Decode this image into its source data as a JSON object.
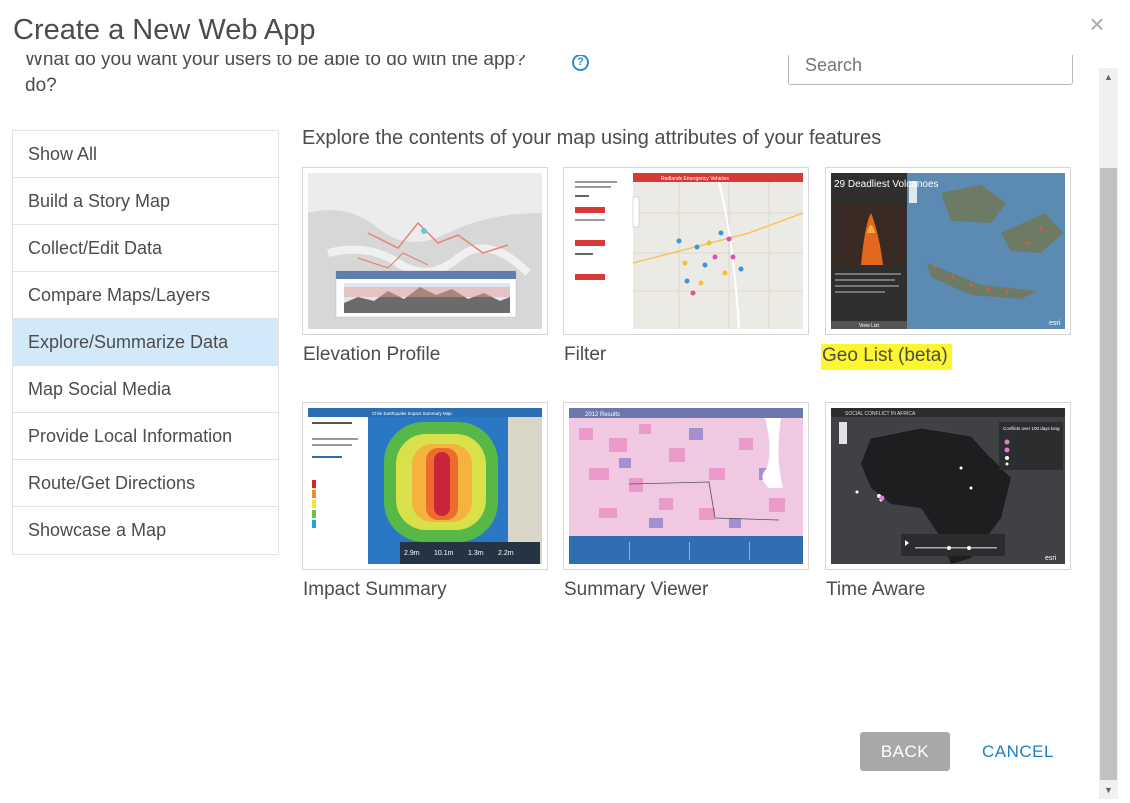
{
  "dialog": {
    "title": "Create a New Web App",
    "close_icon": "close-icon"
  },
  "question": {
    "line1_partial": "What do you want your users to be able to do with the app?",
    "line2": "do?",
    "help_icon": "help-icon"
  },
  "search": {
    "placeholder": "Search"
  },
  "categories": [
    {
      "label": "Show All",
      "selected": false
    },
    {
      "label": "Build a Story Map",
      "selected": false
    },
    {
      "label": "Collect/Edit Data",
      "selected": false
    },
    {
      "label": "Compare Maps/Layers",
      "selected": false
    },
    {
      "label": "Explore/Summarize Data",
      "selected": true
    },
    {
      "label": "Map Social Media",
      "selected": false
    },
    {
      "label": "Provide Local Information",
      "selected": false
    },
    {
      "label": "Route/Get Directions",
      "selected": false
    },
    {
      "label": "Showcase a Map",
      "selected": false
    }
  ],
  "section": {
    "heading": "Explore the contents of your map using attributes of your features"
  },
  "apps": [
    {
      "label": "Elevation Profile",
      "highlighted": false
    },
    {
      "label": "Filter",
      "highlighted": false
    },
    {
      "label": "Geo List (beta)",
      "highlighted": true
    },
    {
      "label": "Impact Summary",
      "highlighted": false
    },
    {
      "label": "Summary Viewer",
      "highlighted": false
    },
    {
      "label": "Time Aware",
      "highlighted": false
    }
  ],
  "thumb_text": {
    "filter_header": "Redlands Emergency Vehicles",
    "geolist_title": "29 Deadliest Volcanoes",
    "geolist_footer": "View List",
    "impact_header": "Chile Earthquake Impact Summary Map",
    "impact_stats": [
      "2.9m",
      "10.1m",
      "1.3m",
      "2.2m"
    ],
    "summary_header": "2012 Results",
    "time_header": "SOCIAL CONFLICT IN AFRICA",
    "time_legend_title": "Conflicts over 100 days long",
    "esri_mark": "esri"
  },
  "buttons": {
    "back": "BACK",
    "cancel": "CANCEL"
  },
  "colors": {
    "accent": "#1b7fc6",
    "selected_bg": "#d2e9f9",
    "highlight": "#fdf62f",
    "back_bg": "#a8a8a8"
  }
}
